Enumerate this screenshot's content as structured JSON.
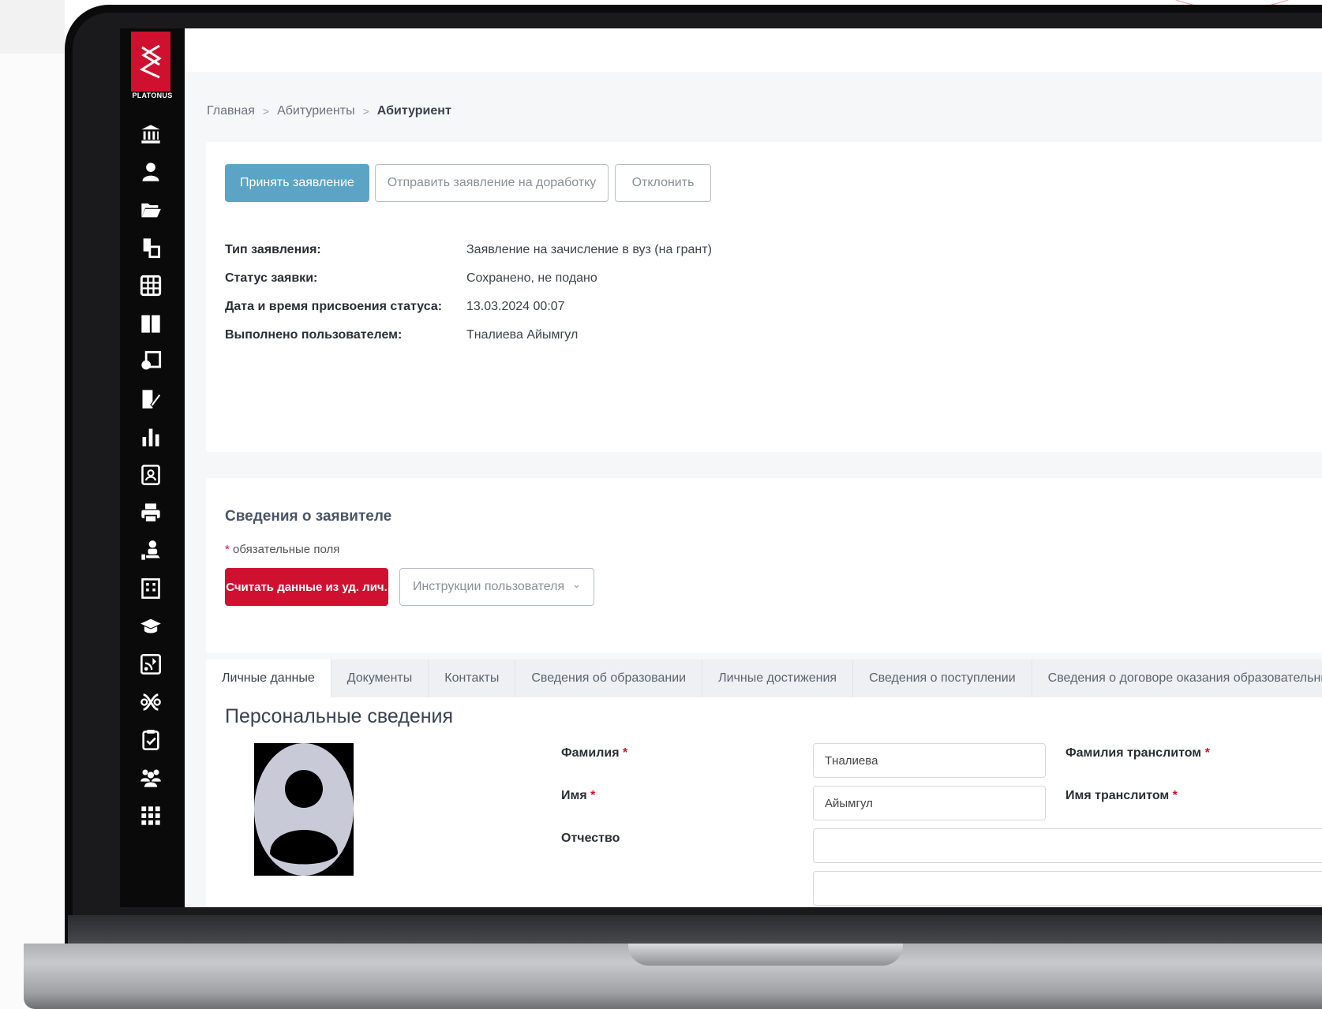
{
  "brand": {
    "logo_text": "PLATONUS",
    "accent": "#d0102f",
    "primary": "#5ba4c6"
  },
  "sidebar": {
    "icons": [
      "university-icon",
      "user-icon",
      "folder-icon",
      "documents-icon",
      "grid-icon",
      "book-icon",
      "notebook-icon",
      "edit-document-icon",
      "bar-chart-icon",
      "id-card-icon",
      "printer-icon",
      "hand-user-icon",
      "building-icon",
      "graduation-cap-icon",
      "rss-card-icon",
      "platonus-mark-icon",
      "clipboard-check-icon",
      "users-group-icon",
      "apps-grid-icon"
    ]
  },
  "breadcrumb": {
    "home": "Главная",
    "applicants": "Абитуриенты",
    "current": "Абитуриент",
    "separator": ">"
  },
  "actions": {
    "accept": "Принять заявление",
    "rework": "Отправить заявление на доработку",
    "reject": "Отклонить"
  },
  "application": {
    "type_label": "Тип заявления:",
    "type_value": "Заявление на зачисление в вуз (на грант)",
    "status_label": "Статус заявки:",
    "status_value": "Сохранено, не подано",
    "date_label": "Дата и время присвоения статуса:",
    "date_value": "13.03.2024 00:07",
    "user_label": "Выполнено пользователем:",
    "user_value": "Тналиева Айымгул"
  },
  "applicant_section": {
    "title": "Сведения о заявителе",
    "required_star": "*",
    "required_note": " обязательные поля",
    "read_id_button": "Считать данные из уд. лич.",
    "instructions_button": "Инструкции пользователя",
    "instructions_chevron": "⌄"
  },
  "tabs": [
    {
      "label": "Личные данные",
      "active": true
    },
    {
      "label": "Документы",
      "active": false
    },
    {
      "label": "Контакты",
      "active": false
    },
    {
      "label": "Сведения об образовании",
      "active": false
    },
    {
      "label": "Личные достижения",
      "active": false
    },
    {
      "label": "Сведения о поступлении",
      "active": false
    },
    {
      "label": "Сведения о договоре оказания образовательных ус",
      "active": false
    }
  ],
  "personal": {
    "title": "Персональные сведения",
    "surname_label": "Фамилия",
    "surname_value": "Тналиева",
    "surname_translit_label": "Фамилия транслитом",
    "name_label": "Имя",
    "name_value": "Айымгул",
    "name_translit_label": "Имя транслитом",
    "patronymic_label": "Отчество",
    "patronymic_value": "",
    "star": "*"
  }
}
